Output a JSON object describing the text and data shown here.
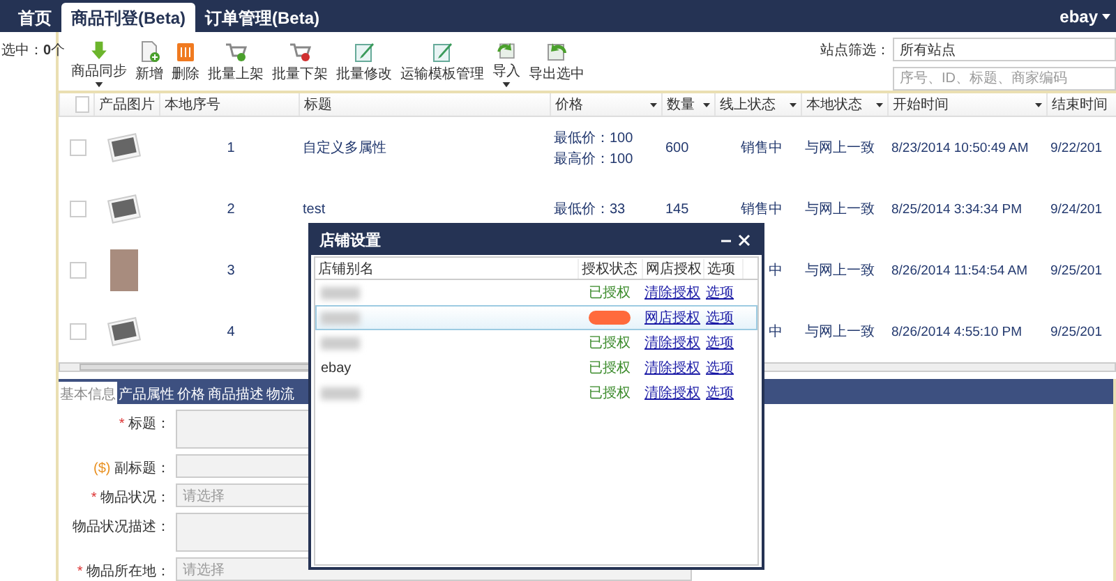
{
  "nav": {
    "tabs": [
      {
        "label": "首页",
        "selected": false
      },
      {
        "label": "商品刊登(Beta)",
        "selected": true
      },
      {
        "label": "订单管理(Beta)",
        "selected": false
      }
    ],
    "account": "ebay"
  },
  "selection_count": "选中：**0**个",
  "toolbar": {
    "buttons": [
      {
        "label": "商品同步",
        "kind": "download",
        "dropdown": true
      },
      {
        "label": "新增",
        "kind": "new-doc",
        "dropdown": false
      },
      {
        "label": "删除",
        "kind": "trash",
        "dropdown": false
      },
      {
        "label": "批量上架",
        "kind": "cart-add",
        "dropdown": false
      },
      {
        "label": "批量下架",
        "kind": "cart-remove",
        "dropdown": false
      },
      {
        "label": "批量修改",
        "kind": "edit",
        "dropdown": false
      },
      {
        "label": "运输模板管理",
        "kind": "edit",
        "dropdown": false
      },
      {
        "label": "导入",
        "kind": "import",
        "dropdown": true
      },
      {
        "label": "导出选中",
        "kind": "export",
        "dropdown": false
      }
    ],
    "site_filter": {
      "label": "站点筛选：",
      "value": "所有站点"
    },
    "search": {
      "placeholder": "序号、ID、标题、商家编码"
    }
  },
  "table": {
    "all_checked": false,
    "columns": [
      {
        "label": "产品图片",
        "menu": false
      },
      {
        "label": "本地序号",
        "menu": false
      },
      {
        "label": "标题",
        "menu": false
      },
      {
        "label": "价格",
        "menu": true
      },
      {
        "label": "数量",
        "menu": true
      },
      {
        "label": "线上状态",
        "menu": true
      },
      {
        "label": "本地状态",
        "menu": true
      },
      {
        "label": "开始时间",
        "menu": true
      },
      {
        "label": "结束时间",
        "menu": false
      }
    ],
    "rows": [
      {
        "checked": false,
        "kind": "placeholder",
        "index": "1",
        "title": "自定义多属性",
        "price": [
          "最低价：100",
          "最高价：100"
        ],
        "quantity": "600",
        "online_status": "销售中",
        "local_status": "与网上一致",
        "start_time": "8/23/2014 10:50:49 AM",
        "end_time": "9/22/201"
      },
      {
        "checked": false,
        "kind": "placeholder",
        "index": "2",
        "title": "test",
        "price": [
          "最低价：33"
        ],
        "quantity": "145",
        "online_status": "销售中",
        "local_status": "与网上一致",
        "start_time": "8/25/2014 3:34:34 PM",
        "end_time": "9/24/201"
      },
      {
        "checked": false,
        "kind": "photo",
        "index": "3",
        "online_status": "中",
        "local_status": "与网上一致",
        "start_time": "8/26/2014 11:54:54 AM",
        "end_time": "9/25/201"
      },
      {
        "checked": false,
        "kind": "placeholder",
        "index": "4",
        "online_status": "中",
        "local_status": "与网上一致",
        "start_time": "8/26/2014 4:55:10 PM",
        "end_time": "9/25/201"
      }
    ]
  },
  "editor": {
    "tabs": [
      {
        "label": "基本信息",
        "selected": true
      },
      {
        "label": "产品属性",
        "selected": false
      },
      {
        "label": "价格",
        "selected": false
      },
      {
        "label": "商品描述",
        "selected": false
      },
      {
        "label": "物流",
        "selected": false
      }
    ],
    "fields": [
      {
        "prefix": {
          "kind": "required",
          "text": "*"
        },
        "label": "标题：",
        "kind": "textarea"
      },
      {
        "prefix": {
          "kind": "fee",
          "text": "($)"
        },
        "label": "副标题：",
        "kind": "input"
      },
      {
        "prefix": {
          "kind": "required",
          "text": "*"
        },
        "label": "物品状况：",
        "kind": "select",
        "placeholder": "请选择"
      },
      {
        "label": "物品状况描述：",
        "kind": "textarea"
      },
      {
        "prefix": {
          "kind": "required",
          "text": "*"
        },
        "label": "物品所在地：",
        "kind": "select",
        "placeholder": "请选择"
      }
    ]
  },
  "dialog": {
    "title": "店铺设置",
    "columns": [
      "店铺别名",
      "授权状态",
      "网店授权",
      "选项"
    ],
    "rows": [
      {
        "name": {
          "kind": "blurred"
        },
        "status": {
          "kind": "text",
          "text": "已授权"
        },
        "action": "清除授权",
        "option": "选项",
        "selected": false
      },
      {
        "name": {
          "kind": "blurred"
        },
        "status": {
          "kind": "redacted"
        },
        "action": "网店授权",
        "option": "选项",
        "selected": true
      },
      {
        "name": {
          "kind": "blurred"
        },
        "status": {
          "kind": "text",
          "text": "已授权"
        },
        "action": "清除授权",
        "option": "选项",
        "selected": false
      },
      {
        "name": {
          "kind": "text",
          "text": "ebay"
        },
        "status": {
          "kind": "text",
          "text": "已授权"
        },
        "action": "清除授权",
        "option": "选项",
        "selected": false
      },
      {
        "name": {
          "kind": "blurred"
        },
        "status": {
          "kind": "text",
          "text": "已授权"
        },
        "action": "清除授权",
        "option": "选项",
        "selected": false
      }
    ]
  }
}
